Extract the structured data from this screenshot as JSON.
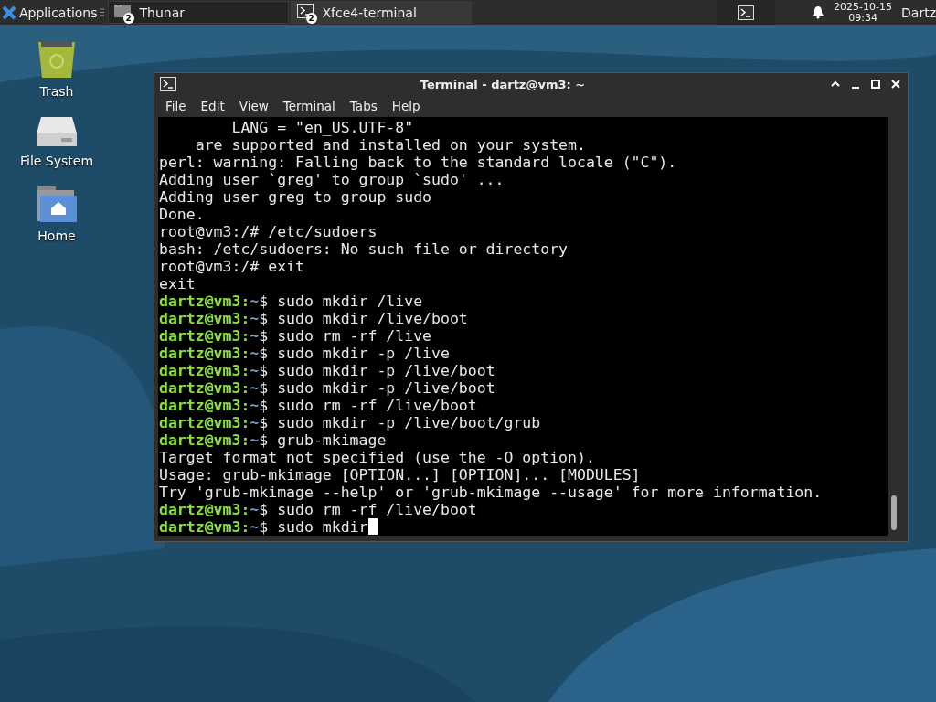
{
  "panel": {
    "menu_label": "Applications",
    "tasks": [
      {
        "label": "Thunar",
        "badge": "2",
        "kind": "folder",
        "selected": false
      },
      {
        "label": "Xfce4-terminal",
        "badge": "2",
        "kind": "terminal",
        "selected": true
      }
    ],
    "clock_date": "2025-10-15",
    "clock_time": "09:34",
    "user": "Dartz"
  },
  "desktop_icons": [
    {
      "label": "Trash",
      "kind": "trash"
    },
    {
      "label": "File System",
      "kind": "drive"
    },
    {
      "label": "Home",
      "kind": "home"
    }
  ],
  "window": {
    "title": "Terminal - dartz@vm3: ~",
    "menu": [
      "File",
      "Edit",
      "View",
      "Terminal",
      "Tabs",
      "Help"
    ],
    "lines": [
      {
        "kind": "output",
        "text": "        LANG = \"en_US.UTF-8\""
      },
      {
        "kind": "output",
        "text": "    are supported and installed on your system."
      },
      {
        "kind": "output",
        "text": "perl: warning: Falling back to the standard locale (\"C\")."
      },
      {
        "kind": "output",
        "text": "Adding user `greg' to group `sudo' ..."
      },
      {
        "kind": "output",
        "text": "Adding user greg to group sudo"
      },
      {
        "kind": "output",
        "text": "Done."
      },
      {
        "kind": "output",
        "text": "root@vm3:/# /etc/sudoers"
      },
      {
        "kind": "output",
        "text": "bash: /etc/sudoers: No such file or directory"
      },
      {
        "kind": "output",
        "text": "root@vm3:/# exit"
      },
      {
        "kind": "output",
        "text": "exit"
      },
      {
        "kind": "prompt",
        "user": "dartz@vm3:",
        "path": "~",
        "command": "$ sudo mkdir /live"
      },
      {
        "kind": "prompt",
        "user": "dartz@vm3:",
        "path": "~",
        "command": "$ sudo mkdir /live/boot"
      },
      {
        "kind": "prompt",
        "user": "dartz@vm3:",
        "path": "~",
        "command": "$ sudo rm -rf /live"
      },
      {
        "kind": "prompt",
        "user": "dartz@vm3:",
        "path": "~",
        "command": "$ sudo mkdir -p /live"
      },
      {
        "kind": "prompt",
        "user": "dartz@vm3:",
        "path": "~",
        "command": "$ sudo mkdir -p /live/boot"
      },
      {
        "kind": "prompt",
        "user": "dartz@vm3:",
        "path": "~",
        "command": "$ sudo mkdir -p /live/boot"
      },
      {
        "kind": "prompt",
        "user": "dartz@vm3:",
        "path": "~",
        "command": "$ sudo rm -rf /live/boot"
      },
      {
        "kind": "prompt",
        "user": "dartz@vm3:",
        "path": "~",
        "command": "$ sudo mkdir -p /live/boot/grub"
      },
      {
        "kind": "prompt",
        "user": "dartz@vm3:",
        "path": "~",
        "command": "$ grub-mkimage"
      },
      {
        "kind": "output",
        "text": "Target format not specified (use the -O option)."
      },
      {
        "kind": "output",
        "text": "Usage: grub-mkimage [OPTION...] [OPTION]... [MODULES]"
      },
      {
        "kind": "output",
        "text": "Try 'grub-mkimage --help' or 'grub-mkimage --usage' for more information."
      },
      {
        "kind": "prompt",
        "user": "dartz@vm3:",
        "path": "~",
        "command": "$ sudo rm -rf /live/boot"
      },
      {
        "kind": "prompt",
        "user": "dartz@vm3:",
        "path": "~",
        "command": "$ sudo mkdir",
        "cursor": true
      }
    ]
  }
}
